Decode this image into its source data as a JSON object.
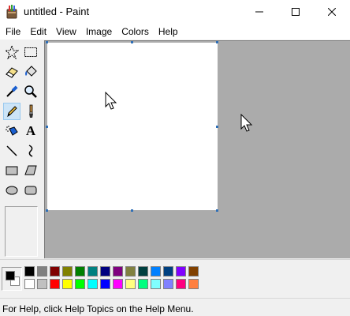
{
  "window": {
    "title": "untitled - Paint",
    "controls": [
      "minimize-icon",
      "maximize-icon",
      "close-icon"
    ]
  },
  "menu": [
    "File",
    "Edit",
    "View",
    "Image",
    "Colors",
    "Help"
  ],
  "tools": [
    {
      "name": "free-form-select",
      "icon": "star-select-icon"
    },
    {
      "name": "select",
      "icon": "rect-select-icon"
    },
    {
      "name": "eraser",
      "icon": "eraser-icon"
    },
    {
      "name": "fill-with-color",
      "icon": "paint-bucket-icon"
    },
    {
      "name": "pick-color",
      "icon": "eyedropper-icon"
    },
    {
      "name": "magnifier",
      "icon": "magnifier-icon"
    },
    {
      "name": "pencil",
      "icon": "pencil-icon",
      "selected": true
    },
    {
      "name": "brush",
      "icon": "brush-icon"
    },
    {
      "name": "airbrush",
      "icon": "airbrush-icon"
    },
    {
      "name": "text",
      "icon": "text-icon",
      "glyph": "A"
    },
    {
      "name": "line",
      "icon": "line-icon"
    },
    {
      "name": "curve",
      "icon": "curve-icon"
    },
    {
      "name": "rectangle",
      "icon": "rectangle-icon"
    },
    {
      "name": "polygon",
      "icon": "polygon-icon"
    },
    {
      "name": "ellipse",
      "icon": "ellipse-icon"
    },
    {
      "name": "rounded-rectangle",
      "icon": "rounded-rectangle-icon"
    }
  ],
  "palette": {
    "foreground": "#000000",
    "background": "#ffffff",
    "colors_row1": [
      "#000000",
      "#808080",
      "#800000",
      "#808000",
      "#008000",
      "#008080",
      "#000080",
      "#800080",
      "#808040",
      "#004040",
      "#0080ff",
      "#004080",
      "#8000ff",
      "#804000"
    ],
    "colors_row2": [
      "#ffffff",
      "#c0c0c0",
      "#ff0000",
      "#ffff00",
      "#00ff00",
      "#00ffff",
      "#0000ff",
      "#ff00ff",
      "#ffff80",
      "#00ff80",
      "#80ffff",
      "#8080ff",
      "#ff0080",
      "#ff8040"
    ]
  },
  "status": {
    "help_text": "For Help, click Help Topics on the Help Menu."
  },
  "colors": {
    "workspace": "#ababab",
    "canvas": "#ffffff",
    "handles": "#2f6fb6",
    "selected_tool": "#cce4f7"
  }
}
